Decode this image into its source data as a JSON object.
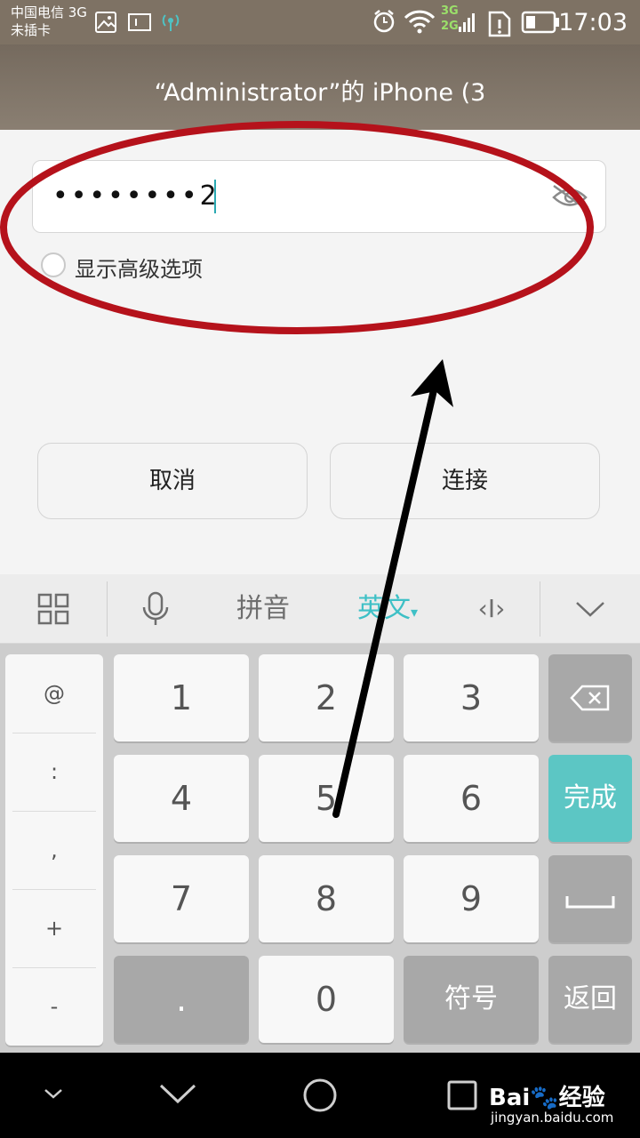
{
  "status_bar": {
    "carrier_line1": "中国电信 3G",
    "carrier_line2": "未插卡",
    "network_top": "3G",
    "network_bottom": "2G",
    "time": "17:03"
  },
  "dialog": {
    "title": "“Administrator”的 iPhone (3",
    "password_value": "••••••••2",
    "show_advanced_label": "显示高级选项",
    "cancel_label": "取消",
    "connect_label": "连接"
  },
  "keyboard": {
    "toolbar": {
      "pinyin_label": "拼音",
      "english_label": "英文",
      "dropdown_mark": "▾",
      "cursor_mark": "‹I›"
    },
    "symbols": [
      "@",
      ":",
      ",",
      "+",
      "-"
    ],
    "keys": {
      "k1": "1",
      "k2": "2",
      "k3": "3",
      "k4": "4",
      "k5": "5",
      "k6": "6",
      "k7": "7",
      "k8": "8",
      "k9": "9",
      "k0": "0",
      "dot": ".",
      "symbols_label": "符号",
      "done_label": "完成",
      "back_label": "返回"
    },
    "accent_color": "#5cc6c4"
  },
  "watermark": {
    "logo_text": "Bai🐾经验",
    "url": "jingyan.baidu.com"
  },
  "annotation_color": "#b5121b"
}
